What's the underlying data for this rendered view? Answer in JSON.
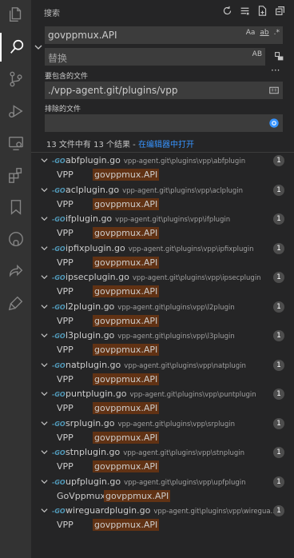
{
  "header": {
    "title": "搜索"
  },
  "search": {
    "query": "govppmux.API",
    "query_opts": [
      "Aa",
      "ab",
      ".*"
    ],
    "replace_placeholder": "替换",
    "replace_opt": "AB",
    "include_label": "要包含的文件",
    "include_value": "./vpp-agent.git/plugins/vpp",
    "exclude_label": "排除的文件",
    "exclude_value": ""
  },
  "summary": {
    "text": "13 文件中有 13 个结果 - ",
    "link": "在编辑器中打开"
  },
  "results": [
    {
      "file": "abfplugin.go",
      "path": "vpp-agent.git\\plugins\\vpp\\abfplugin",
      "count": "1",
      "prefix": "VPP",
      "match": "govppmux.API"
    },
    {
      "file": "aclplugin.go",
      "path": "vpp-agent.git\\plugins\\vpp\\aclplugin",
      "count": "1",
      "prefix": "VPP",
      "match": "govppmux.API"
    },
    {
      "file": "ifplugin.go",
      "path": "vpp-agent.git\\plugins\\vpp\\ifplugin",
      "count": "1",
      "prefix": "VPP",
      "match": "govppmux.API"
    },
    {
      "file": "ipfixplugin.go",
      "path": "vpp-agent.git\\plugins\\vpp\\ipfixplugin",
      "count": "1",
      "prefix": "VPP",
      "match": "govppmux.API"
    },
    {
      "file": "ipsecplugin.go",
      "path": "vpp-agent.git\\plugins\\vpp\\ipsecplugin",
      "count": "1",
      "prefix": "VPP",
      "match": "govppmux.API"
    },
    {
      "file": "l2plugin.go",
      "path": "vpp-agent.git\\plugins\\vpp\\l2plugin",
      "count": "1",
      "prefix": "VPP",
      "match": "govppmux.API"
    },
    {
      "file": "l3plugin.go",
      "path": "vpp-agent.git\\plugins\\vpp\\l3plugin",
      "count": "1",
      "prefix": "VPP",
      "match": "govppmux.API"
    },
    {
      "file": "natplugin.go",
      "path": "vpp-agent.git\\plugins\\vpp\\natplugin",
      "count": "1",
      "prefix": "VPP",
      "match": "govppmux.API"
    },
    {
      "file": "puntplugin.go",
      "path": "vpp-agent.git\\plugins\\vpp\\puntplugin",
      "count": "1",
      "prefix": "VPP",
      "match": "govppmux.API"
    },
    {
      "file": "srplugin.go",
      "path": "vpp-agent.git\\plugins\\vpp\\srplugin",
      "count": "1",
      "prefix": "VPP",
      "match": "govppmux.API"
    },
    {
      "file": "stnplugin.go",
      "path": "vpp-agent.git\\plugins\\vpp\\stnplugin",
      "count": "1",
      "prefix": "VPP",
      "match": "govppmux.API"
    },
    {
      "file": "upfplugin.go",
      "path": "vpp-agent.git\\plugins\\vpp\\upfplugin",
      "count": "1",
      "prefix": "GoVppmux",
      "match": "govppmux.API"
    },
    {
      "file": "wireguardplugin.go",
      "path": "vpp-agent.git\\plugins\\vpp\\wiregua...",
      "count": "1",
      "prefix": "VPP",
      "match": "govppmux.API"
    }
  ],
  "colors": {
    "accent": "#3794ff",
    "match_bg": "#613214",
    "sidebar": "#252526",
    "activity": "#333333"
  },
  "activity_icons": [
    "files-icon",
    "search-icon",
    "source-control-icon",
    "run-debug-icon",
    "remote-explorer-icon",
    "extensions-icon",
    "bookmarks-icon",
    "github-icon",
    "live-share-icon",
    "tools-icon"
  ]
}
